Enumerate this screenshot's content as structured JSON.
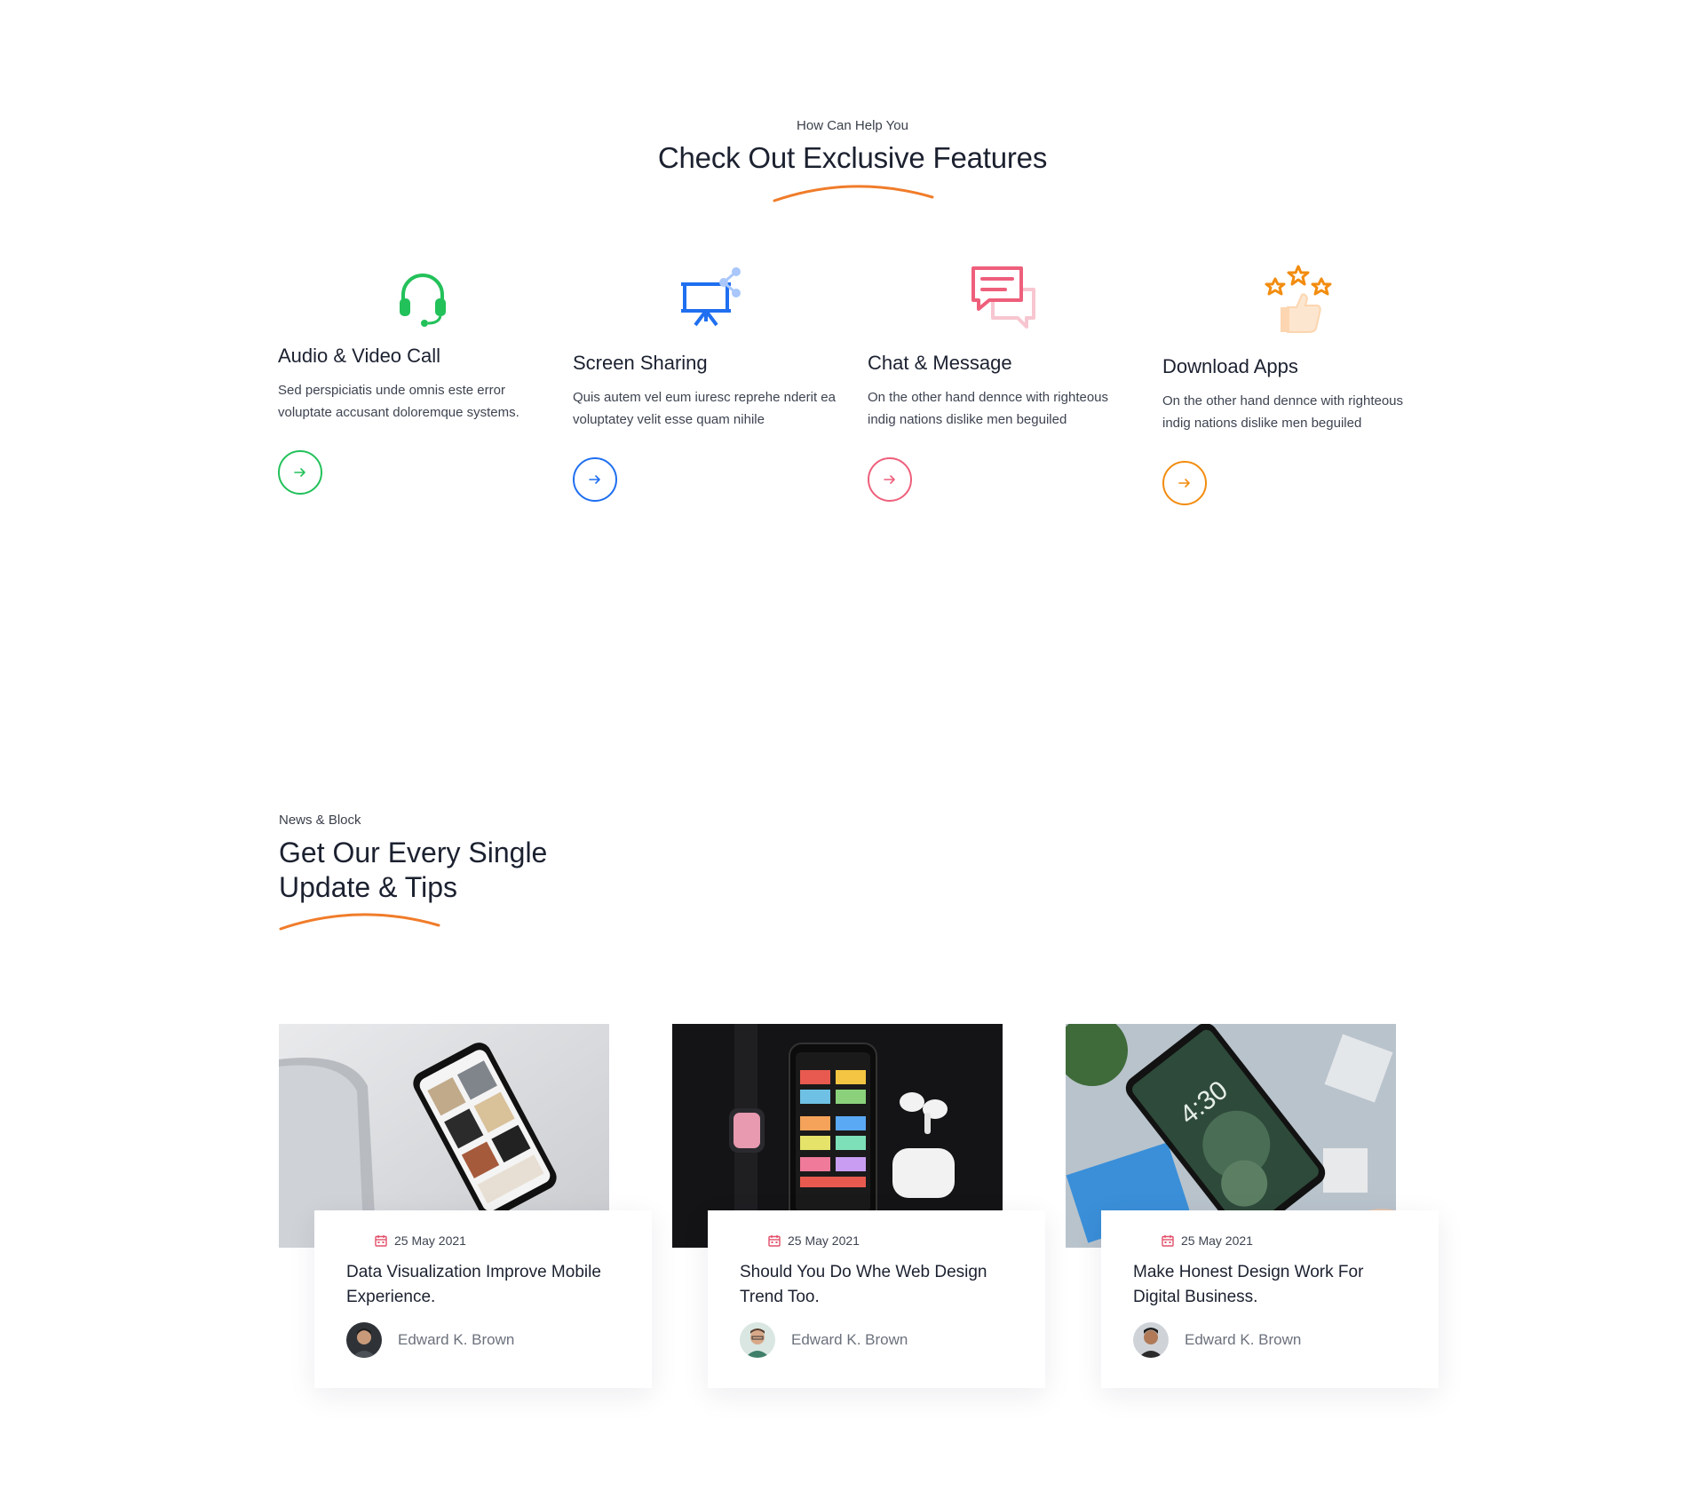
{
  "features": {
    "eyebrow": "How Can Help You",
    "title": "Check Out Exclusive Features",
    "items": [
      {
        "title": "Audio & Video Call",
        "text": "Sed perspiciatis unde omnis este error voluptate accusant doloremque systems.",
        "icon": "headset-icon",
        "color": "#23c15a"
      },
      {
        "title": "Screen Sharing",
        "text": "Quis autem vel eum iuresc reprehe nderit ea voluptatey velit esse quam nihile",
        "icon": "presentation-share-icon",
        "color": "#1f6ff0"
      },
      {
        "title": "Chat & Message",
        "text": "On the other hand dennce with righteous indig nations dislike men beguiled",
        "icon": "chat-bubbles-icon",
        "color": "#ee5f7b"
      },
      {
        "title": "Download Apps",
        "text": "On the other hand dennce with righteous indig nations dislike men beguiled",
        "icon": "thumbs-up-stars-icon",
        "color": "#f28c0f"
      }
    ]
  },
  "news": {
    "eyebrow": "News & Block",
    "title": "Get Our Every Single Update & Tips",
    "posts": [
      {
        "date": "25 May 2021",
        "title": "Data Visualization Improve Mobile Experience.",
        "author": "Edward K. Brown"
      },
      {
        "date": "25 May 2021",
        "title": "Should You Do Whe Web Design Trend Too.",
        "author": "Edward K. Brown"
      },
      {
        "date": "25 May 2021",
        "title": "Make Honest Design Work For Digital Business.",
        "author": "Edward K. Brown"
      }
    ]
  },
  "colors": {
    "accent": "#f07c2a",
    "heading": "#1c2130"
  }
}
